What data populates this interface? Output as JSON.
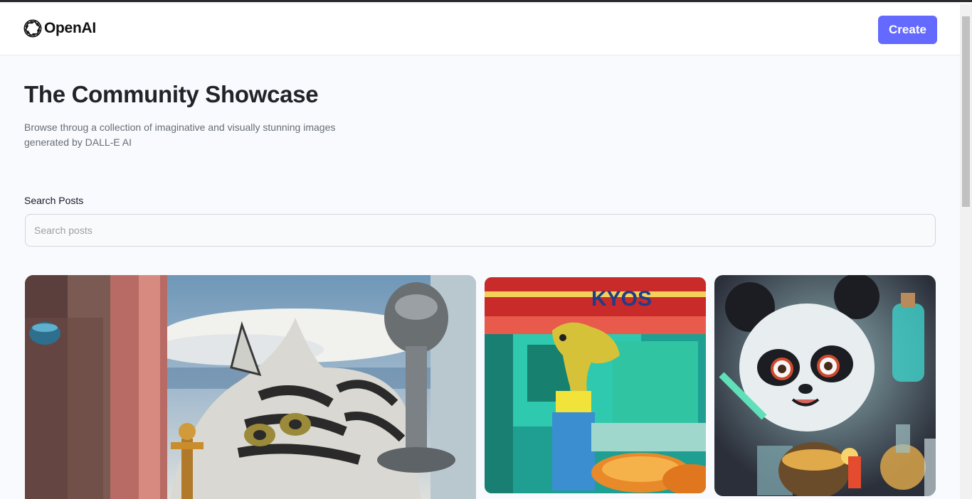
{
  "header": {
    "logo_text": "OpenAI",
    "create_label": "Create"
  },
  "hero": {
    "title": "The Community Showcase",
    "subtitle": "Browse throug a collection of imaginative and visually stunning images generated by DALL-E AI"
  },
  "search": {
    "label": "Search Posts",
    "placeholder": "Search posts",
    "value": ""
  },
  "posts": [
    {
      "image": "surreal-striped-cat-painting"
    },
    {
      "image": "dinosaur-cook-food-stand"
    },
    {
      "image": "panda-scientist-lab"
    }
  ],
  "colors": {
    "accent": "#6469ff",
    "background": "#f9fafe",
    "title": "#222328",
    "subtitle": "#666e75"
  }
}
